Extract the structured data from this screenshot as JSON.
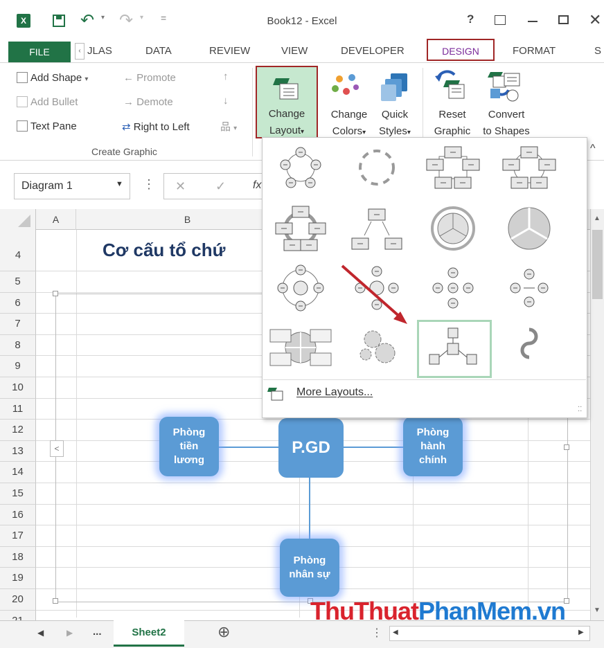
{
  "window": {
    "title": "Book12 - Excel",
    "help": "?",
    "close": "✕"
  },
  "qat": {
    "excel_logo": "X",
    "undo": "↶",
    "redo": "↷",
    "dropdown": "▾",
    "more": "="
  },
  "tabs": [
    {
      "label": "FILE"
    },
    {
      "label": "JLAS"
    },
    {
      "label": "DATA"
    },
    {
      "label": "REVIEW"
    },
    {
      "label": "VIEW"
    },
    {
      "label": "DEVELOPER"
    },
    {
      "label": "DESIGN"
    },
    {
      "label": "FORMAT"
    },
    {
      "label": "S"
    }
  ],
  "ribbon": {
    "add_shape": "Add Shape",
    "add_bullet": "Add Bullet",
    "text_pane": "Text Pane",
    "promote": "Promote",
    "demote": "Demote",
    "right_to_left": "Right to Left",
    "group_label": "Create Graphic",
    "change_layout_1": "Change",
    "change_layout_2": "Layout",
    "change_colors_1": "Change",
    "change_colors_2": "Colors",
    "quick_styles_1": "Quick",
    "quick_styles_2": "Styles",
    "reset_graphic_1": "Reset",
    "reset_graphic_2": "Graphic",
    "convert_1": "Convert",
    "convert_2": "to Shapes",
    "collapse": "^"
  },
  "formula_bar": {
    "name_box": "Diagram 1",
    "cancel": "✕",
    "enter": "✓",
    "fx": "fx"
  },
  "sheet": {
    "columns": [
      "A",
      "B"
    ],
    "rows": [
      "4",
      "5",
      "6",
      "7",
      "8",
      "9",
      "10",
      "11",
      "12",
      "13",
      "14",
      "15",
      "16",
      "17",
      "18",
      "19",
      "20",
      "21"
    ],
    "title": "Cơ cấu tổ chứ"
  },
  "smartart": {
    "nodes": [
      {
        "text": "Phòng\ntiền\nlương"
      },
      {
        "text": "P.GD"
      },
      {
        "text": "Phòng\nhành\nchính"
      },
      {
        "text": "Phòng\nnhân sự"
      }
    ],
    "pane_toggle": "<"
  },
  "gallery": {
    "more_layouts": "More Layouts..."
  },
  "sheet_tabs": {
    "prev": "◀",
    "next": "▶",
    "ellipsis": "...",
    "active": "Sheet2",
    "add": "⊕"
  },
  "watermark": {
    "part1": "ThuThuat",
    "part2": "PhanMem",
    "part3": ".vn"
  },
  "colors": {
    "excel_green": "#217346",
    "node_blue": "#5b9bd5",
    "highlight_red": "#a02626",
    "design_purple": "#7a2a9a",
    "watermark_red": "#d9232d",
    "watermark_blue": "#1f7ad1"
  }
}
